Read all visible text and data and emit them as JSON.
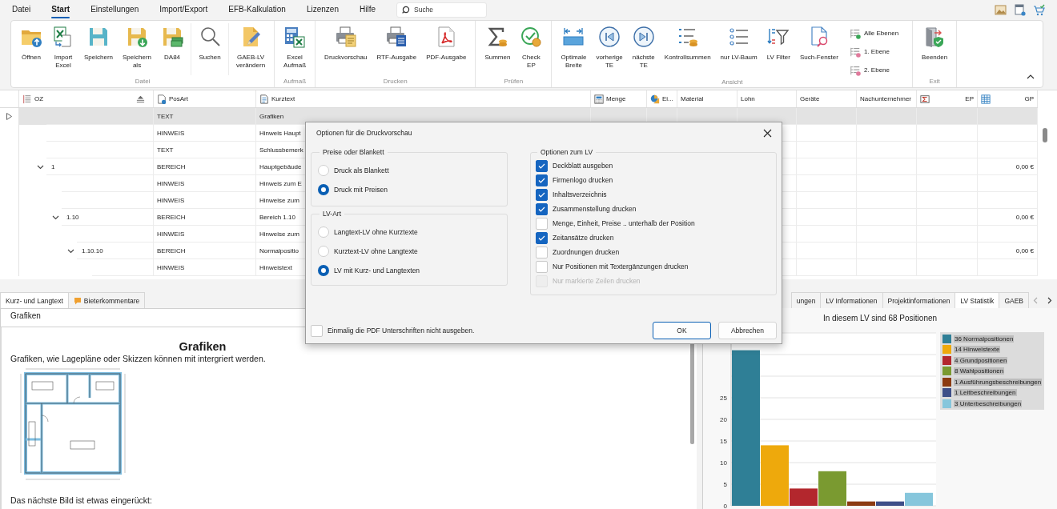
{
  "menu_bar": {
    "items": [
      {
        "label": "Datei",
        "selected": false
      },
      {
        "label": "Start",
        "selected": true
      },
      {
        "label": "Einstellungen",
        "selected": false
      },
      {
        "label": "Import/Export",
        "selected": false
      },
      {
        "label": "EFB-Kalkulation",
        "selected": false
      },
      {
        "label": "Lizenzen",
        "selected": false
      },
      {
        "label": "Hilfe",
        "selected": false
      }
    ],
    "search": {
      "placeholder": "Suche"
    }
  },
  "ribbon": {
    "groups": [
      {
        "label": "Datei",
        "sections": [
          {
            "buttons": [
              {
                "label": "Öffnen",
                "kind": "large"
              },
              {
                "label": "Import\nExcel",
                "kind": "large"
              },
              {
                "label": "Speichern",
                "kind": "large"
              },
              {
                "label": "Speichern\nals",
                "kind": "large"
              },
              {
                "label": "DA84",
                "kind": "large"
              }
            ]
          },
          {
            "buttons": [
              {
                "label": "Suchen",
                "kind": "large"
              }
            ]
          },
          {
            "buttons": [
              {
                "label": "GAEB-LV\nverändern",
                "kind": "large"
              }
            ]
          }
        ]
      },
      {
        "label": "Aufmaß",
        "sections": [
          {
            "buttons": [
              {
                "label": "Excel\nAufmaß",
                "kind": "large"
              }
            ]
          }
        ]
      },
      {
        "label": "Drucken",
        "sections": [
          {
            "buttons": [
              {
                "label": "Druckvorschau",
                "kind": "large"
              },
              {
                "label": "RTF-Ausgabe",
                "kind": "large"
              },
              {
                "label": "PDF-Ausgabe",
                "kind": "large"
              }
            ]
          }
        ]
      },
      {
        "label": "Prüfen",
        "sections": [
          {
            "buttons": [
              {
                "label": "Summen",
                "kind": "large"
              },
              {
                "label": "Check\nEP",
                "kind": "large"
              }
            ]
          }
        ]
      },
      {
        "label": "Ansicht",
        "sections": [
          {
            "buttons": [
              {
                "label": "Optimale\nBreite",
                "kind": "large"
              },
              {
                "label": "vorherige\nTE",
                "kind": "large"
              },
              {
                "label": "nächste\nTE",
                "kind": "large"
              },
              {
                "label": "Kontrollsummen",
                "kind": "large"
              },
              {
                "label": "nur LV-Baum",
                "kind": "large"
              },
              {
                "label": "LV Filter",
                "kind": "large"
              },
              {
                "label": "Such-Fenster",
                "kind": "large"
              },
              {
                "label": "Alle Ebenen",
                "kind": "small"
              },
              {
                "label": "1. Ebene",
                "kind": "small"
              },
              {
                "label": "2. Ebene",
                "kind": "small"
              }
            ]
          }
        ]
      },
      {
        "label": "Exit",
        "sections": [
          {
            "buttons": [
              {
                "label": "Beenden",
                "kind": "large"
              }
            ]
          }
        ]
      }
    ]
  },
  "grid": {
    "columns": [
      {
        "label": "OZ"
      },
      {
        "label": "PosArt"
      },
      {
        "label": "Kurztext"
      },
      {
        "label": "Menge"
      },
      {
        "label": "Ei..."
      },
      {
        "label": "Material"
      },
      {
        "label": "Lohn"
      },
      {
        "label": "Geräte"
      },
      {
        "label": "Nachunternehmer"
      },
      {
        "label": "EP"
      },
      {
        "label": "GP"
      }
    ],
    "rows": [
      {
        "posart": "TEXT",
        "kurztext": "Grafiken",
        "selected": true
      },
      {
        "posart": "HINWEIS",
        "kurztext": "Hinweis Haupt",
        "selected": false
      },
      {
        "posart": "TEXT",
        "kurztext": "Schlussbemerk",
        "selected": false
      },
      {
        "oz": "1",
        "posart": "BEREICH",
        "kurztext": "Hauptgebäude",
        "gp": "0,00 €",
        "expanded": true,
        "selected": false,
        "children": [
          {
            "posart": "HINWEIS",
            "kurztext": "Hinweis zum E",
            "selected": false
          },
          {
            "posart": "HINWEIS",
            "kurztext": "Hinweise zum",
            "selected": false
          },
          {
            "oz": "1.10",
            "posart": "BEREICH",
            "kurztext": "Bereich 1.10",
            "gp": "0,00 €",
            "expanded": true,
            "selected": false,
            "children": [
              {
                "posart": "HINWEIS",
                "kurztext": "Hinweise zum",
                "selected": false
              },
              {
                "oz": "1.10.10",
                "posart": "BEREICH",
                "kurztext": "Normalpositio",
                "gp": "0,00 €",
                "expanded": true,
                "selected": false,
                "children": [
                  {
                    "posart": "HINWEIS",
                    "kurztext": "Hinweistext",
                    "selected": false
                  }
                ]
              }
            ]
          }
        ]
      }
    ]
  },
  "detail_panel": {
    "tabs": [
      {
        "label": "Kurz- und Langtext",
        "selected": true
      },
      {
        "label": "Bieterkommentare",
        "selected": false
      }
    ],
    "short_text": "Grafiken",
    "document": {
      "title": "Grafiken",
      "blocks": [
        {
          "kind": "paragraph",
          "text": "Grafiken, wie Lagepläne oder Skizzen können mit intergriert werden."
        },
        {
          "kind": "image"
        },
        {
          "kind": "paragraph",
          "text": "Das nächste Bild ist etwas eingerückt:"
        }
      ]
    }
  },
  "statistics_panel": {
    "tabs": [
      {
        "label": "ungen",
        "selected": false
      },
      {
        "label": "LV Informationen",
        "selected": false
      },
      {
        "label": "Projektinformationen",
        "selected": false
      },
      {
        "label": "LV Statistik",
        "selected": true
      },
      {
        "label": "GAEB",
        "selected": false
      }
    ],
    "chart_data": {
      "type": "bar",
      "title": "In diesem LV sind 68 Positionen",
      "series": [
        {
          "name": "36 Normalpositionen",
          "color": "#2f7f96",
          "values": [
            36
          ]
        },
        {
          "name": "14 Hinweistexte",
          "color": "#eea90c",
          "values": [
            14
          ]
        },
        {
          "name": "4 Grundpositionen",
          "color": "#b3272d",
          "values": [
            4
          ]
        },
        {
          "name": "8 Wahlpositionen",
          "color": "#7a9a30",
          "values": [
            8
          ]
        },
        {
          "name": "1 Ausführungsbeschreibungen",
          "color": "#8b3b12",
          "values": [
            1
          ]
        },
        {
          "name": "1 Leitbeschreibungen",
          "color": "#3e4f88",
          "values": [
            1
          ]
        },
        {
          "name": "3 Unterbeschreibungen",
          "color": "#86c6dc",
          "values": [
            3
          ]
        }
      ],
      "ylim": [
        0,
        40
      ],
      "yticks": [
        0,
        5,
        10,
        15,
        20,
        25
      ],
      "grid": true,
      "legend": true
    }
  },
  "dialog": {
    "title": "Optionen für die Druckvorschau",
    "radio_groups": [
      {
        "title": "Preise oder Blankett",
        "options": [
          {
            "label": "Druck als Blankett",
            "selected": false
          },
          {
            "label": "Druck mit Preisen",
            "selected": true
          }
        ]
      },
      {
        "title": "LV-Art",
        "options": [
          {
            "label": "Langtext-LV ohne Kurztexte",
            "selected": false
          },
          {
            "label": "Kurztext-LV ohne Langtexte",
            "selected": false
          },
          {
            "label": "LV mit Kurz- und Langtexten",
            "selected": true
          }
        ]
      }
    ],
    "options_group": {
      "title": "Optionen zum LV",
      "options": [
        {
          "label": "Deckblatt ausgeben",
          "checked": true,
          "disabled": false
        },
        {
          "label": "Firmenlogo drucken",
          "checked": true,
          "disabled": false
        },
        {
          "label": "Inhaltsverzeichnis",
          "checked": true,
          "disabled": false
        },
        {
          "label": "Zusammenstellung drucken",
          "checked": true,
          "disabled": false
        },
        {
          "label": "Menge, Einheit, Preise .. unterhalb der Position",
          "checked": false,
          "disabled": false
        },
        {
          "label": "Zeitansätze drucken",
          "checked": true,
          "disabled": false
        },
        {
          "label": "Zuordnungen drucken",
          "checked": false,
          "disabled": false
        },
        {
          "label": "Nur Positionen mit Textergänzungen drucken",
          "checked": false,
          "disabled": false
        },
        {
          "label": "Nur markierte Zeilen drucken",
          "checked": false,
          "disabled": true
        }
      ]
    },
    "footer_option": {
      "label": "Einmalig die PDF Unterschriften nicht ausgeben.",
      "checked": false
    },
    "buttons": [
      {
        "label": "OK",
        "default": true
      },
      {
        "label": "Abbrechen",
        "default": false
      }
    ]
  }
}
